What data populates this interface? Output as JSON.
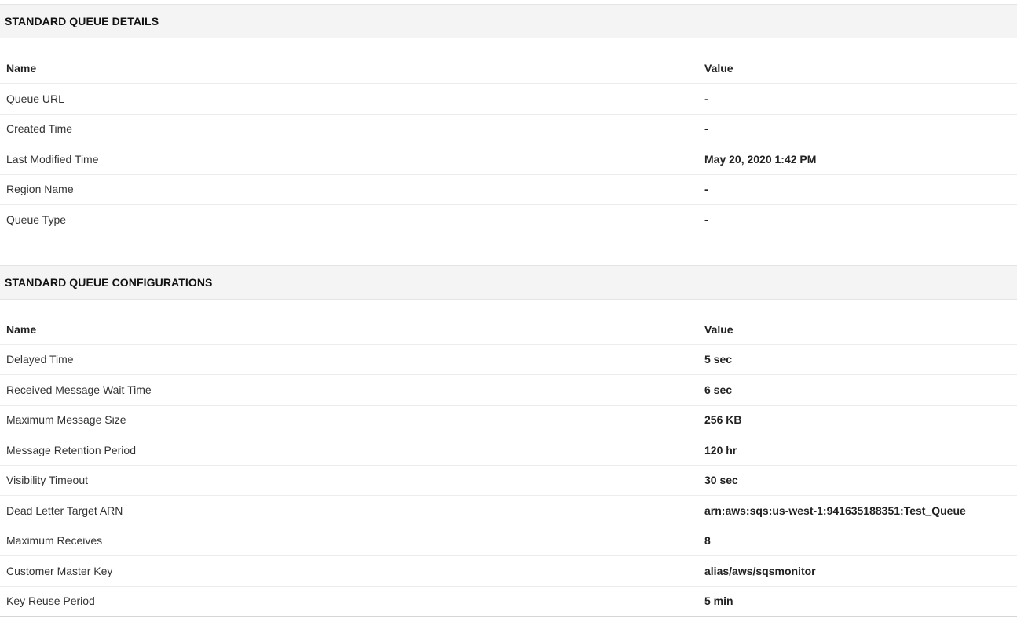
{
  "details": {
    "title": "STANDARD QUEUE DETAILS",
    "columns": {
      "name": "Name",
      "value": "Value"
    },
    "rows": [
      {
        "name": "Queue URL",
        "value": "-"
      },
      {
        "name": "Created Time",
        "value": "-"
      },
      {
        "name": "Last Modified Time",
        "value": "May 20, 2020 1:42 PM"
      },
      {
        "name": "Region Name",
        "value": "-"
      },
      {
        "name": "Queue Type",
        "value": "-"
      }
    ]
  },
  "configurations": {
    "title": "STANDARD QUEUE CONFIGURATIONS",
    "columns": {
      "name": "Name",
      "value": "Value"
    },
    "rows": [
      {
        "name": "Delayed Time",
        "value": "5 sec"
      },
      {
        "name": "Received Message Wait Time",
        "value": "6 sec"
      },
      {
        "name": "Maximum Message Size",
        "value": "256 KB"
      },
      {
        "name": "Message Retention Period",
        "value": "120 hr"
      },
      {
        "name": "Visibility Timeout",
        "value": "30 sec"
      },
      {
        "name": "Dead Letter Target ARN",
        "value": "arn:aws:sqs:us-west-1:941635188351:Test_Queue"
      },
      {
        "name": "Maximum Receives",
        "value": "8"
      },
      {
        "name": "Customer Master Key",
        "value": "alias/aws/sqsmonitor"
      },
      {
        "name": "Key Reuse Period",
        "value": "5 min"
      }
    ]
  }
}
